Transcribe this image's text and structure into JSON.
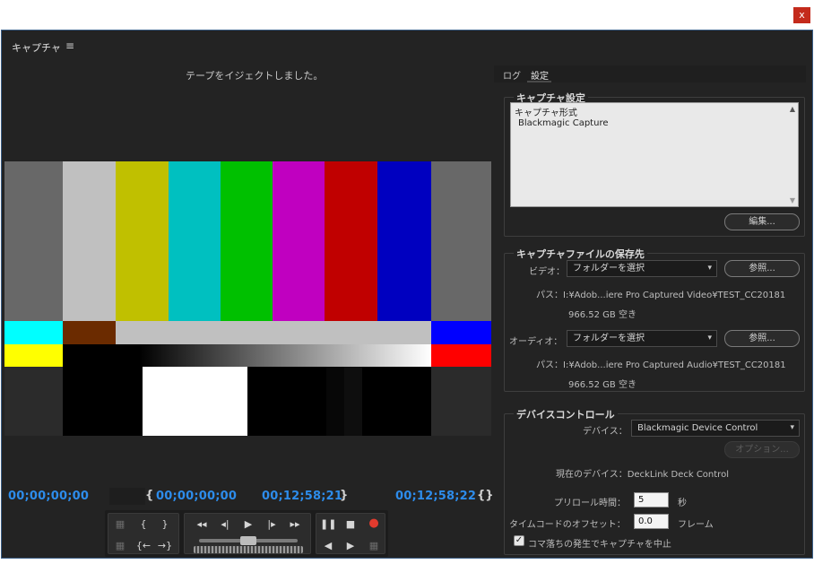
{
  "window": {
    "close_label": "x"
  },
  "panel": {
    "title": "キャプチャ",
    "menu_icon": "hamburger-menu-icon"
  },
  "preview": {
    "status_text": "テープをイジェクトしました。",
    "colors": {
      "top": [
        "#686868",
        "#c0c0c0",
        "#c0c000",
        "#00c0c0",
        "#00c000",
        "#c000c0",
        "#c00000",
        "#0000c0",
        "#686868"
      ],
      "mid_left": "#00ffff",
      "mid_brown": "#6b2b00",
      "mid_gray": "#c0c0c0",
      "mid_right": "#0000ff",
      "low_left": "#ffff00",
      "low_right": "#ff0000",
      "black": "#000000",
      "white": "#ffffff",
      "dark": "#2b2b2b"
    }
  },
  "timecodes": {
    "current": "00;00;00;00",
    "in_point": "00;00;00;00",
    "out_point": "00;12;58;21",
    "duration": "00;12;58;22",
    "in_brace": "{",
    "out_brace": "}",
    "duration_icon": "{}"
  },
  "transport": {
    "icons": [
      "clapper-icon",
      "set-in-icon",
      "set-out-icon",
      "clapper-dim-icon",
      "goto-in-icon",
      "goto-out-icon",
      "rewind-icon",
      "step-back-icon",
      "play-icon",
      "step-forward-icon",
      "fast-forward-icon",
      "shuttle-slider",
      "jog-wheel",
      "pause-icon",
      "stop-icon",
      "record-icon",
      "slow-reverse-icon",
      "slow-play-icon",
      "scene-search-icon"
    ]
  },
  "right_panel": {
    "tabs": [
      {
        "label": "ログ"
      },
      {
        "label": "設定"
      }
    ],
    "active_tab": "設定",
    "capture_settings": {
      "title": "キャプチャ設定",
      "list": [
        "キャプチャ形式",
        "Blackmagic Capture"
      ],
      "edit_button": "編集..."
    },
    "save_location": {
      "title": "キャプチャファイルの保存先",
      "video_label": "ビデオ：",
      "video_dropdown": "フォルダーを選択",
      "video_browse": "参照...",
      "video_path": "パス：I:¥Adob...iere Pro Captured Video¥TEST_CC20181",
      "video_free": "966.52 GB 空き",
      "audio_label": "オーディオ：",
      "audio_dropdown": "フォルダーを選択",
      "audio_browse": "参照...",
      "audio_path": "パス：I:¥Adob...iere Pro Captured Audio¥TEST_CC20181",
      "audio_free": "966.52 GB 空き"
    },
    "device_control": {
      "title": "デバイスコントロール",
      "device_label": "デバイス：",
      "device_dropdown": "Blackmagic Device Control",
      "options_button": "オプション...",
      "current_device": "現在のデバイス：DeckLink Deck Control",
      "preroll_label": "プリロール時間：",
      "preroll_value": "5",
      "preroll_unit": "秒",
      "offset_label": "タイムコードのオフセット：",
      "offset_value": "0.0",
      "offset_unit": "フレーム",
      "abort_checkbox_label": "コマ落ちの発生でキャプチャを中止",
      "abort_checked": true
    }
  }
}
